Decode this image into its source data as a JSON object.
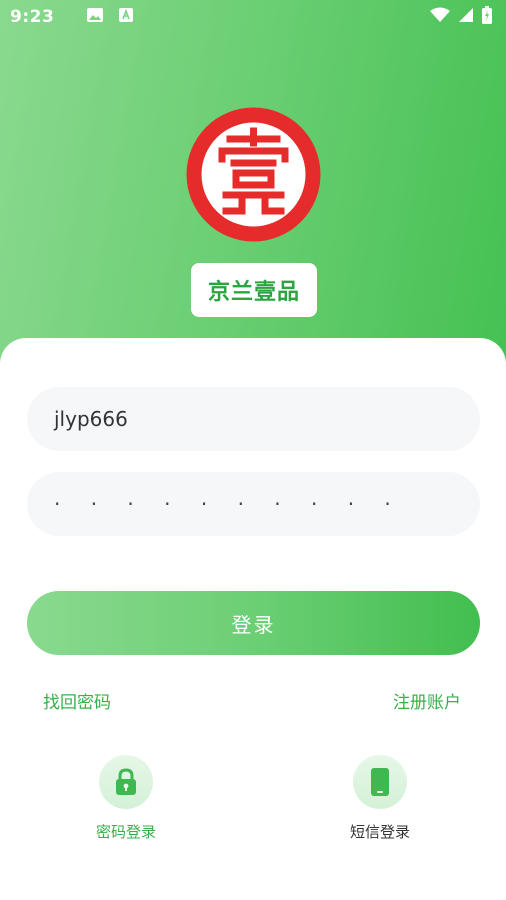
{
  "status_bar": {
    "time": "9:23"
  },
  "brand": {
    "name": "京兰壹品",
    "logo_glyph": "壹",
    "logo_color": "#e62b2b"
  },
  "form": {
    "username_value": "jlyp666",
    "password_mask": "· · · · · · · · · ·",
    "login_label": "登录"
  },
  "links": {
    "forgot_password": "找回密码",
    "register": "注册账户"
  },
  "login_methods": [
    {
      "label": "密码登录",
      "icon": "lock-icon"
    },
    {
      "label": "短信登录",
      "icon": "phone-icon"
    }
  ],
  "colors": {
    "accent": "#36b14a",
    "field_bg": "#f6f7f9"
  }
}
